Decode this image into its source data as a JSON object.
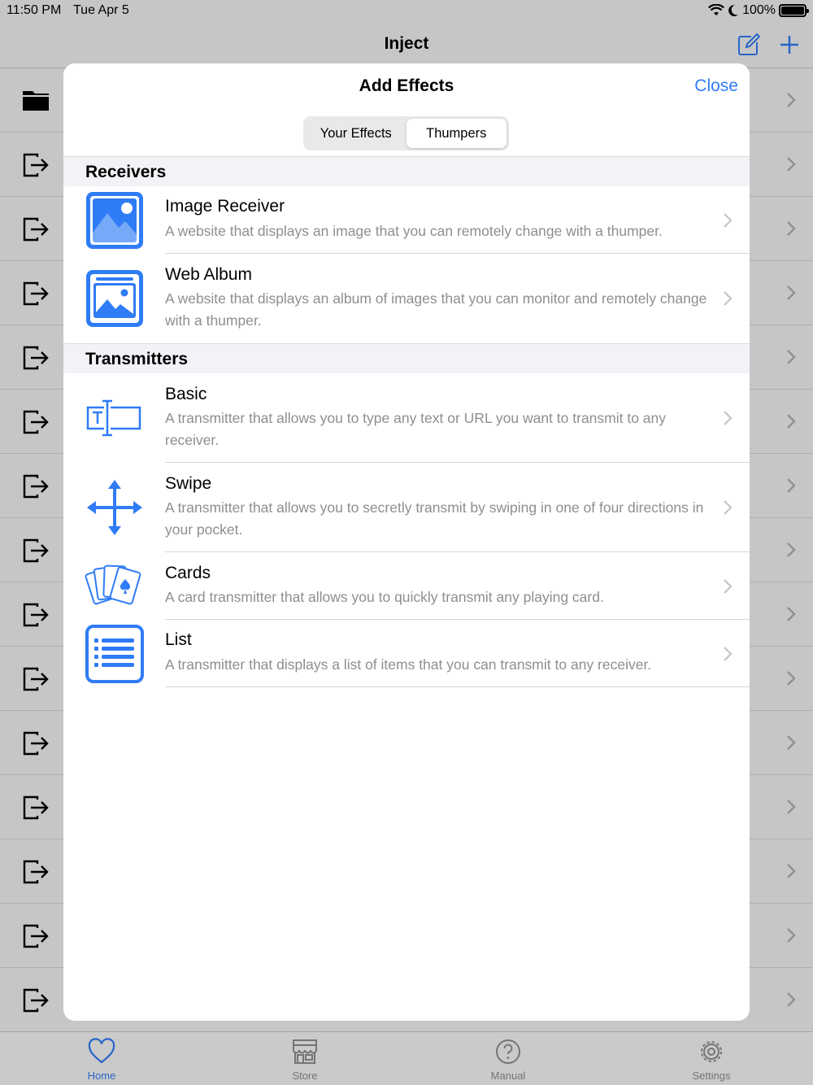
{
  "status_bar": {
    "time": "11:50 PM",
    "date": "Tue Apr 5",
    "battery": "100%"
  },
  "nav": {
    "title": "Inject"
  },
  "modal": {
    "title": "Add Effects",
    "close_label": "Close",
    "segments": [
      "Your Effects",
      "Thumpers"
    ],
    "selected_segment": "Thumpers",
    "sections": [
      {
        "header": "Receivers",
        "items": [
          {
            "title": "Image Receiver",
            "subtitle": "A website that displays an image that you can remotely change with a thumper.",
            "icon": "image-icon"
          },
          {
            "title": "Web Album",
            "subtitle": "A website that displays an album of images that you can monitor and remotely change with a thumper.",
            "icon": "photo-album-icon"
          }
        ]
      },
      {
        "header": "Transmitters",
        "items": [
          {
            "title": "Basic",
            "subtitle": "A transmitter that allows you to type any text or URL you want to transmit to any receiver.",
            "icon": "text-field-icon"
          },
          {
            "title": "Swipe",
            "subtitle": "A transmitter that allows you to secretly transmit by swiping in one of four directions in your pocket.",
            "icon": "four-arrows-icon"
          },
          {
            "title": "Cards",
            "subtitle": "A card transmitter that allows you to quickly transmit any playing card.",
            "icon": "playing-cards-icon"
          },
          {
            "title": "List",
            "subtitle": "A transmitter that displays a list of items that you can transmit to any receiver.",
            "icon": "list-icon"
          }
        ]
      }
    ]
  },
  "tab_bar": {
    "tabs": [
      {
        "label": "Home",
        "icon": "heart-icon"
      },
      {
        "label": "Store",
        "icon": "store-icon"
      },
      {
        "label": "Manual",
        "icon": "question-icon"
      },
      {
        "label": "Settings",
        "icon": "gear-icon"
      }
    ],
    "active": "Home"
  },
  "colors": {
    "accent": "#2f7cf6",
    "secondary_text": "#8e8e93",
    "section_bg": "#f2f2f7"
  }
}
